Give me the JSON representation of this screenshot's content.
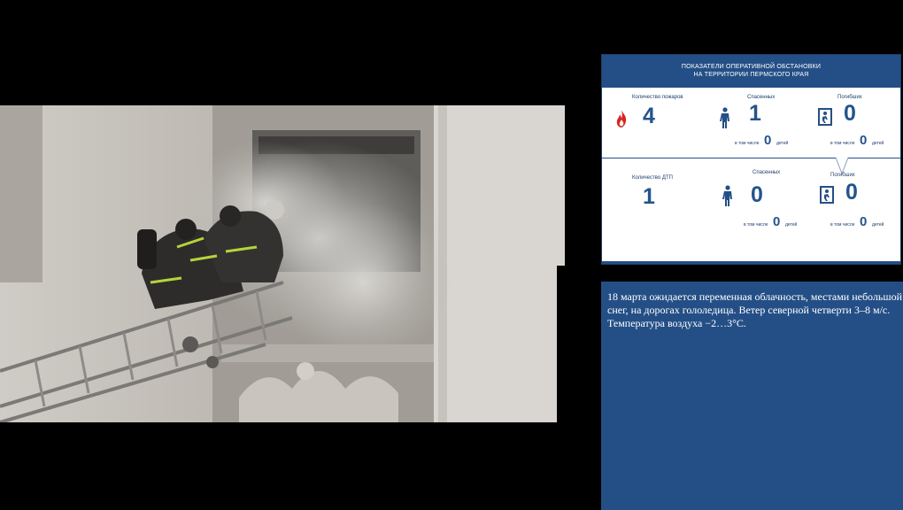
{
  "header": {
    "line1": "ПОКАЗАТЕЛИ ОПЕРАТИВНОЙ ОБСТАНОВКИ",
    "line2": "НА ТЕРРИТОРИИ ПЕРМСКОГО КРАЯ"
  },
  "fires": {
    "count_label": "Количество пожаров",
    "count": "4",
    "rescued_label": "Спасенных",
    "rescued": "1",
    "rescued_children_prefix": "в том числе",
    "rescued_children": "0",
    "rescued_children_suffix": "детей",
    "dead_label": "Погибших",
    "dead": "0",
    "dead_children_prefix": "в том числе",
    "dead_children": "0",
    "dead_children_suffix": "детей"
  },
  "accidents": {
    "count_label": "Количество ДТП",
    "count": "1",
    "rescued_label": "Спасенных",
    "rescued": "0",
    "rescued_children_prefix": "в том числе",
    "rescued_children": "0",
    "rescued_children_suffix": "детей",
    "dead_label": "Погибших",
    "dead": "0",
    "dead_children_prefix": "в том числе",
    "dead_children": "0",
    "dead_children_suffix": "детей"
  },
  "icons": {
    "fire": "fire-icon",
    "rescued": "rescued-person-icon",
    "dead": "exit-door-icon"
  },
  "weather": {
    "line1": "18 марта ожидается переменная облачность, местами небольшой",
    "line2": "снег, на дорогах гололедица. Ветер северной четверти 3–8 м/с.",
    "line3": "Температура воздуха −2…3°С."
  },
  "colors": {
    "accent": "#244f86",
    "number": "#24548c",
    "fire": "#d9231f"
  }
}
